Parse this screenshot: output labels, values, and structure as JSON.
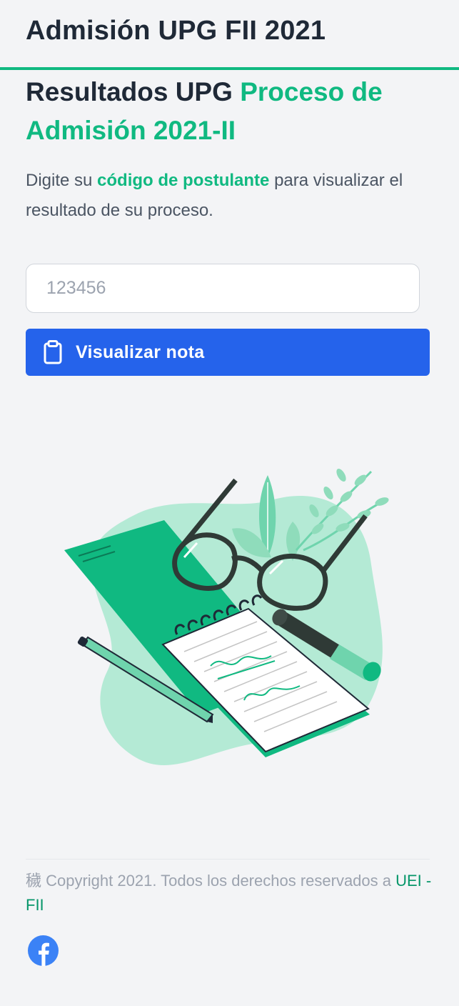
{
  "header": {
    "title": "Admisión UPG FII 2021"
  },
  "hero": {
    "title_plain": "Resultados UPG",
    "title_accent": "Proceso de Admisión 2021-II"
  },
  "instructions": {
    "prefix": "Digite su",
    "highlight": "código de postulante",
    "suffix": "para visualizar el resultado de su proceso."
  },
  "form": {
    "code_placeholder": "123456",
    "code_value": "",
    "submit_label": "Visualizar nota",
    "submit_icon": "clipboard-icon"
  },
  "illustration": {
    "name": "notebook-glasses-illustration"
  },
  "footer": {
    "copyright_text": "穢 Copyright 2021. Todos los derechos reservados a",
    "org_link": "UEI - FII",
    "social_icon": "facebook-icon"
  },
  "colors": {
    "accent_green": "#10b981",
    "button_blue": "#2563eb",
    "text_dark": "#1f2937",
    "background": "#f3f4f6"
  }
}
